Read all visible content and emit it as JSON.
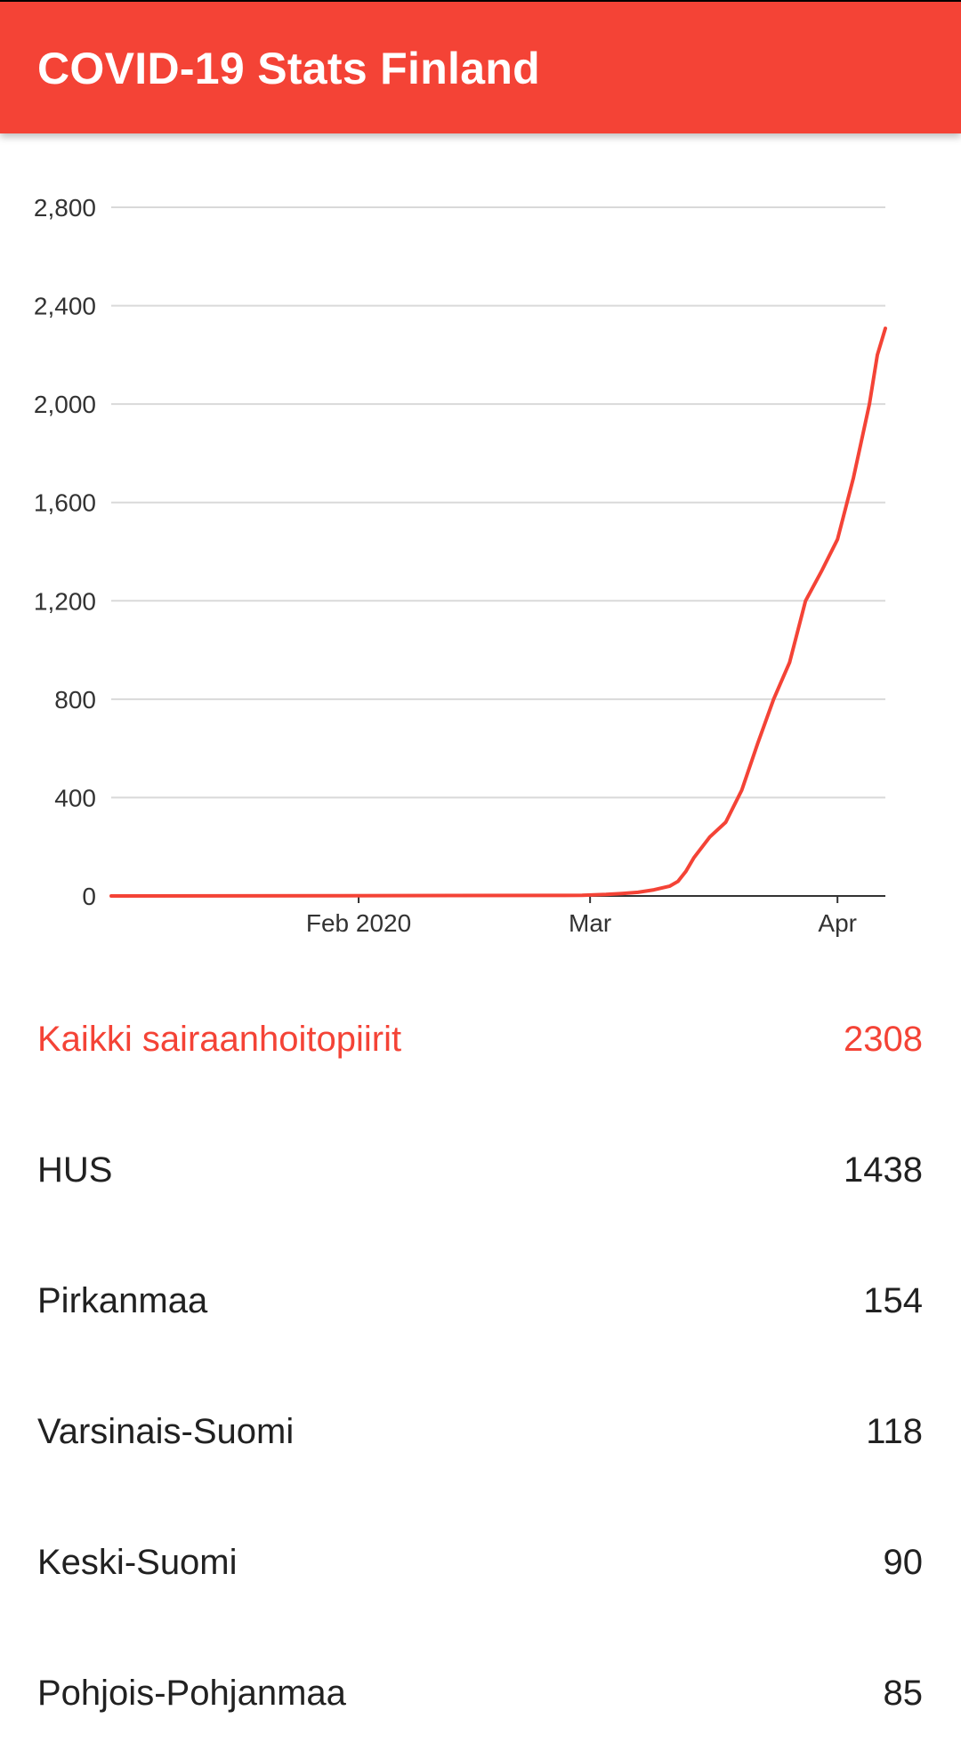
{
  "app_bar": {
    "title": "COVID-19 Stats Finland",
    "color": "#f44336"
  },
  "chart_data": {
    "type": "line",
    "series": [
      {
        "x": [
          "2020-01-01",
          "2020-01-29",
          "2020-02-26",
          "2020-02-29",
          "2020-03-03",
          "2020-03-05",
          "2020-03-07",
          "2020-03-09",
          "2020-03-11",
          "2020-03-12",
          "2020-03-13",
          "2020-03-14",
          "2020-03-16",
          "2020-03-18",
          "2020-03-20",
          "2020-03-22",
          "2020-03-24",
          "2020-03-26",
          "2020-03-28",
          "2020-03-30",
          "2020-04-01",
          "2020-04-03",
          "2020-04-05",
          "2020-04-06",
          "2020-04-07"
        ],
        "values": [
          0,
          1,
          2,
          3,
          6,
          10,
          15,
          25,
          40,
          59,
          100,
          155,
          240,
          300,
          430,
          620,
          800,
          950,
          1200,
          1320,
          1450,
          1700,
          2000,
          2200,
          2308
        ]
      }
    ],
    "ylim": [
      0,
      2800
    ],
    "yticks": [
      0,
      400,
      800,
      1200,
      1600,
      2000,
      2400,
      2800
    ],
    "ytick_labels": [
      "0",
      "400",
      "800",
      "1,200",
      "1,600",
      "2,000",
      "2,400",
      "2,800"
    ],
    "xlim": [
      "2020-01-01",
      "2020-04-07"
    ],
    "xticks": [
      {
        "date": "2020-02-01",
        "label": "Feb 2020"
      },
      {
        "date": "2020-03-01",
        "label": "Mar"
      },
      {
        "date": "2020-04-01",
        "label": "Apr"
      }
    ],
    "grid": true,
    "line_color": "#f44336"
  },
  "regions": [
    {
      "label": "Kaikki sairaanhoitopiirit",
      "value": "2308",
      "highlight": true
    },
    {
      "label": "HUS",
      "value": "1438",
      "highlight": false
    },
    {
      "label": "Pirkanmaa",
      "value": "154",
      "highlight": false
    },
    {
      "label": "Varsinais-Suomi",
      "value": "118",
      "highlight": false
    },
    {
      "label": "Keski-Suomi",
      "value": "90",
      "highlight": false
    },
    {
      "label": "Pohjois-Pohjanmaa",
      "value": "85",
      "highlight": false
    }
  ]
}
